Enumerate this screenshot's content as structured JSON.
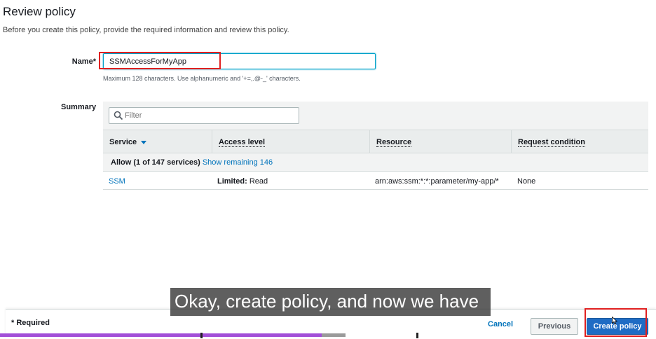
{
  "page": {
    "title": "Review policy",
    "description": "Before you create this policy, provide the required information and review this policy."
  },
  "name_field": {
    "label": "Name*",
    "value": "SSMAccessForMyApp",
    "hint": "Maximum 128 characters. Use alphanumeric and '+=,.@-_' characters."
  },
  "summary": {
    "label": "Summary",
    "filter_placeholder": "Filter",
    "columns": [
      "Service",
      "Access level",
      "Resource",
      "Request condition"
    ],
    "group": {
      "prefix": "Allow (1 of 147 services)",
      "link": "Show remaining 146"
    },
    "rows": [
      {
        "service": "SSM",
        "access_level_bold": "Limited:",
        "access_level_rest": " Read",
        "resource": "arn:aws:ssm:*:*:parameter/my-app/*",
        "condition": "None"
      }
    ]
  },
  "subtitle": "Okay, create policy, and now we have",
  "footer": {
    "required_note": "* Required",
    "cancel_label": "Cancel",
    "previous_label": "Previous",
    "create_label": "Create policy"
  },
  "video_progress": {
    "played_fraction": 0.49,
    "buffered_fraction": 0.526
  },
  "colors": {
    "link": "#0073bb",
    "primary_button": "#1f6cc4",
    "highlight": "#e02020",
    "progress": "#a24fd8"
  }
}
